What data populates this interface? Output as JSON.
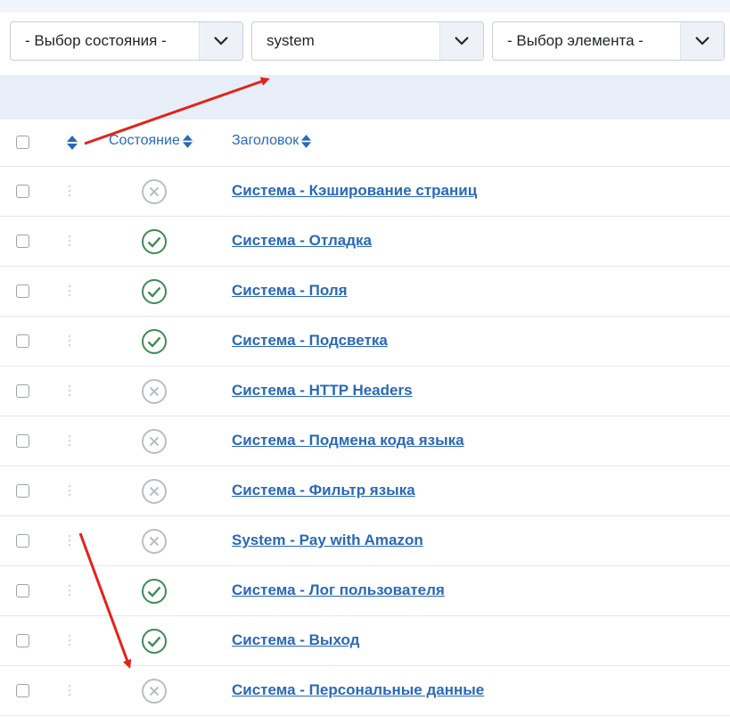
{
  "filters": {
    "state_select": {
      "value": "- Выбор состояния -"
    },
    "search_select": {
      "value": "system"
    },
    "element_select": {
      "value": "- Выбор элемента -"
    }
  },
  "table": {
    "headers": {
      "state": "Состояние",
      "title": "Заголовок"
    },
    "rows": [
      {
        "title": "Система - Кэширование страниц",
        "status": "disabled"
      },
      {
        "title": "Система - Отладка",
        "status": "enabled"
      },
      {
        "title": "Система - Поля",
        "status": "enabled"
      },
      {
        "title": "Система - Подсветка",
        "status": "enabled"
      },
      {
        "title": "Система - HTTP Headers",
        "status": "disabled"
      },
      {
        "title": "Система - Подмена кода языка",
        "status": "disabled"
      },
      {
        "title": "Система - Фильтр языка",
        "status": "disabled"
      },
      {
        "title": "System - Pay with Amazon",
        "status": "disabled"
      },
      {
        "title": "Система - Лог пользователя",
        "status": "enabled"
      },
      {
        "title": "Система - Выход",
        "status": "enabled"
      },
      {
        "title": "Система - Персональные данные",
        "status": "disabled"
      }
    ]
  },
  "colors": {
    "link": "#2a69b8",
    "enabled": "#3f8a55",
    "disabled": "#b9bec5",
    "annotation_arrow": "#e2231a"
  },
  "icons": {
    "caret": "chevron-down-icon",
    "sort": "sort-icon",
    "drag": "drag-handle-icon",
    "enabled": "check-circle-icon",
    "disabled": "x-circle-icon"
  }
}
